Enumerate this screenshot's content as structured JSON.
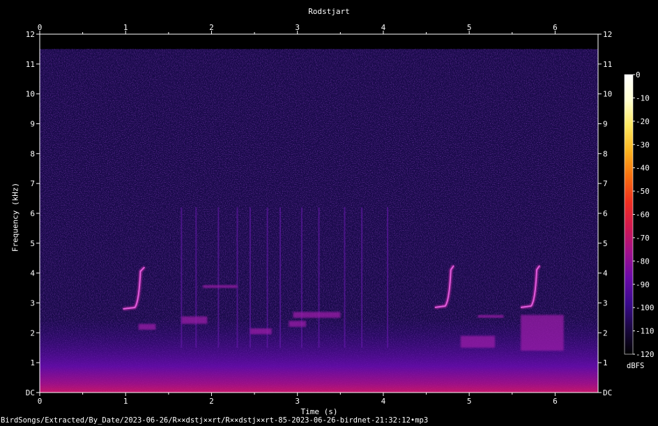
{
  "chart_data": {
    "type": "heatmap",
    "title": "Rodstjart",
    "xlabel": "Time (s)",
    "ylabel": "Frequency (kHz)",
    "xlim": [
      0,
      6.5
    ],
    "ylim": [
      0,
      12
    ],
    "x_ticks": [
      {
        "v": 0,
        "label": "0"
      },
      {
        "v": 1,
        "label": "1"
      },
      {
        "v": 2,
        "label": "2"
      },
      {
        "v": 3,
        "label": "3"
      },
      {
        "v": 4,
        "label": "4"
      },
      {
        "v": 5,
        "label": "5"
      },
      {
        "v": 6,
        "label": "6"
      }
    ],
    "y_ticks": [
      {
        "v": 0,
        "label": "DC"
      },
      {
        "v": 1,
        "label": "1"
      },
      {
        "v": 2,
        "label": "2"
      },
      {
        "v": 3,
        "label": "3"
      },
      {
        "v": 4,
        "label": "4"
      },
      {
        "v": 5,
        "label": "5"
      },
      {
        "v": 6,
        "label": "6"
      },
      {
        "v": 7,
        "label": "7"
      },
      {
        "v": 8,
        "label": "8"
      },
      {
        "v": 9,
        "label": "9"
      },
      {
        "v": 10,
        "label": "10"
      },
      {
        "v": 11,
        "label": "11"
      },
      {
        "v": 12,
        "label": "12"
      }
    ],
    "signal_max_khz": 11.5,
    "calls": [
      {
        "t_start": 0.97,
        "t_end": 1.22,
        "f_low": 2.8,
        "f_high": 4.2
      },
      {
        "t_start": 4.6,
        "t_end": 4.82,
        "f_low": 2.85,
        "f_high": 4.25
      },
      {
        "t_start": 5.6,
        "t_end": 5.82,
        "f_low": 2.85,
        "f_high": 4.25
      }
    ],
    "bands": [
      {
        "t_start": 1.15,
        "t_end": 1.35,
        "f_low": 2.1,
        "f_high": 2.3
      },
      {
        "t_start": 1.65,
        "t_end": 1.95,
        "f_low": 2.3,
        "f_high": 2.55
      },
      {
        "t_start": 1.9,
        "t_end": 2.3,
        "f_low": 3.5,
        "f_high": 3.6
      },
      {
        "t_start": 2.45,
        "t_end": 2.7,
        "f_low": 1.95,
        "f_high": 2.15
      },
      {
        "t_start": 2.95,
        "t_end": 3.5,
        "f_low": 2.5,
        "f_high": 2.7
      },
      {
        "t_start": 2.9,
        "t_end": 3.1,
        "f_low": 2.2,
        "f_high": 2.4
      },
      {
        "t_start": 4.9,
        "t_end": 5.3,
        "f_low": 1.5,
        "f_high": 1.9
      },
      {
        "t_start": 5.1,
        "t_end": 5.4,
        "f_low": 2.5,
        "f_high": 2.6
      },
      {
        "t_start": 5.6,
        "t_end": 6.1,
        "f_low": 1.4,
        "f_high": 2.6
      }
    ],
    "transients": [
      1.65,
      1.82,
      2.08,
      2.3,
      2.45,
      2.65,
      2.8,
      3.05,
      3.25,
      3.55,
      3.75,
      4.05
    ],
    "colorbar": {
      "label": "dBFS",
      "min": -120,
      "max": 0,
      "ticks": [
        {
          "v": 0,
          "label": "0"
        },
        {
          "v": -10,
          "label": "-10"
        },
        {
          "v": -20,
          "label": "-20"
        },
        {
          "v": -30,
          "label": "-30"
        },
        {
          "v": -40,
          "label": "-40"
        },
        {
          "v": -50,
          "label": "-50"
        },
        {
          "v": -60,
          "label": "-60"
        },
        {
          "v": -70,
          "label": "-70"
        },
        {
          "v": -80,
          "label": "-80"
        },
        {
          "v": -90,
          "label": "-90"
        },
        {
          "v": -100,
          "label": "-100"
        },
        {
          "v": -110,
          "label": "-110"
        },
        {
          "v": -120,
          "label": "-120"
        }
      ],
      "stops": [
        "#000000",
        "#1a0840",
        "#3a0a8c",
        "#6a0aa8",
        "#a0108c",
        "#d01850",
        "#f03020",
        "#f87010",
        "#fcb420",
        "#fde860",
        "#ffffd0",
        "#ffffff"
      ]
    }
  },
  "footer": "BirdSongs/Extracted/By_Date/2023-06-26/R××dstj××rt/R××dstj××rt-85-2023-06-26-birdnet-21:32:12•mp3"
}
